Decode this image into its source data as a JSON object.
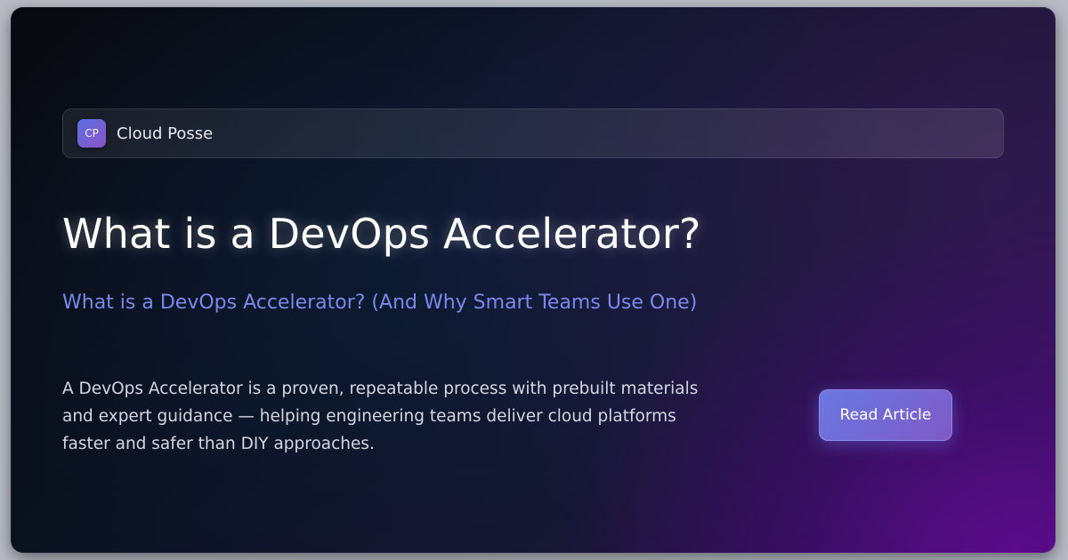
{
  "brand": {
    "logo_text": "CP",
    "name": "Cloud Posse"
  },
  "article": {
    "title": "What is a DevOps Accelerator?",
    "subtitle": "What is a DevOps Accelerator? (And Why Smart Teams Use One)",
    "description": "A DevOps Accelerator is a proven, repeatable process with prebuilt materials and expert guidance — helping engineering teams deliver cloud platforms faster and safer than DIY approaches."
  },
  "cta": {
    "label": "Read Article"
  },
  "colors": {
    "accent": "#7b88ee",
    "button_start": "#6a78e2",
    "button_end": "#7e5ac6",
    "background_dark": "#08090f",
    "background_purple": "#5c0c8c"
  }
}
